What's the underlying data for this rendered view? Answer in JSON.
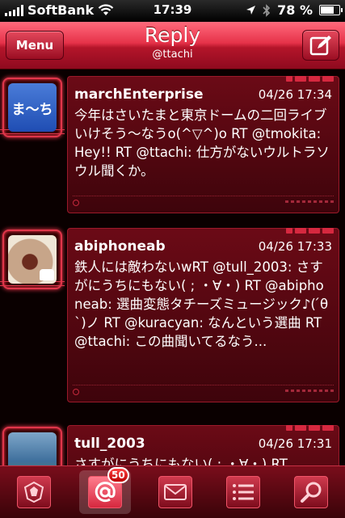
{
  "status_bar": {
    "carrier": "SoftBank",
    "time": "17:39",
    "battery": "78 %",
    "battery_level": 0.78
  },
  "nav": {
    "menu_label": "Menu",
    "title": "Reply",
    "subtitle": "@ttachi"
  },
  "tweets": [
    {
      "user": "marchEnterprise",
      "time": "04/26 17:34",
      "avatar_text": "ま〜ち",
      "text": "今年はさいたまと東京ドームの二回ライブいけそう〜なうo(^▽^)o RT @tmokita: Hey!! RT @ttachi: 仕方がないウルトラソウル聞くか。"
    },
    {
      "user": "abiphoneab",
      "time": "04/26 17:33",
      "text": "鉄人には敵わないwRT @tull_2003: さすがにうちにもない( ; ・∀・) RT @abiphoneab: 選曲変態タチーズミュージック♪( ́θ`)ノ RT @kuracyan: なんという選曲 RT @ttachi: この曲聞いてるなう..."
    },
    {
      "user": "tull_2003",
      "time": "04/26 17:31",
      "text": "さすがにうちにもない( ; ・∀・) RT"
    }
  ],
  "tabbar": {
    "badge_count": "50"
  },
  "colors": {
    "accent": "#e63249",
    "card": "#5a0812"
  }
}
